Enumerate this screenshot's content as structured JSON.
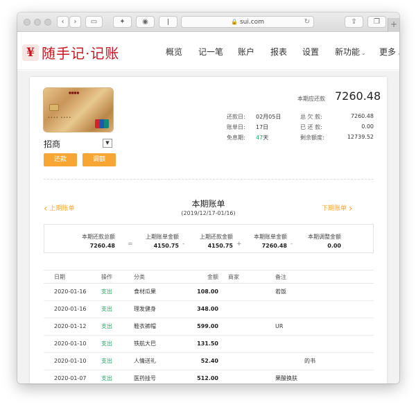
{
  "browser": {
    "url": "sui.com"
  },
  "site": {
    "logo_mark": "¥",
    "logo_text": "随手记·记账",
    "nav": [
      {
        "label": "概览"
      },
      {
        "label": "记一笔"
      },
      {
        "label": "账户"
      },
      {
        "label": "报表"
      },
      {
        "label": "设置"
      },
      {
        "label": "新功能"
      },
      {
        "label": "更多"
      }
    ]
  },
  "card": {
    "bank_name": "招商",
    "pay_button": "还款",
    "limit_button": "调额",
    "due_label": "本期应还款",
    "due_amount": "7260.48",
    "info_left": [
      {
        "label": "还款日:",
        "value": "02月05日"
      },
      {
        "label": "账单日:",
        "value": "17日"
      },
      {
        "label": "免息期:",
        "value_num": "47",
        "value_unit": "天"
      }
    ],
    "info_right": [
      {
        "label": "总 欠 款:",
        "value": "7260.48"
      },
      {
        "label": "已 还 款:",
        "value": "0.00"
      },
      {
        "label": "剩余额度:",
        "value": "12739.52"
      }
    ]
  },
  "bill": {
    "prev_label": "上期账单",
    "next_label": "下期账单",
    "title": "本期账单",
    "period": "(2019/12/17-01/16)",
    "summary": [
      {
        "label": "本期还款总额",
        "value": "7260.48"
      },
      {
        "label": "上期账单金额",
        "value": "4150.75"
      },
      {
        "label": "上期还款金额",
        "value": "4150.75"
      },
      {
        "label": "本期账单金额",
        "value": "7260.48"
      },
      {
        "label": "本期调整金额",
        "value": "0.00"
      }
    ],
    "operators": [
      "=",
      "-",
      "+",
      "-"
    ]
  },
  "table": {
    "headers": {
      "date": "日期",
      "op": "操作",
      "category": "分类",
      "amount": "金额",
      "merchant": "商家",
      "note": "备注"
    },
    "rows": [
      {
        "date": "2020-01-16",
        "op": "支出",
        "category": "食材瓜果",
        "amount": "108.00",
        "merchant": "",
        "note": "若饭"
      },
      {
        "date": "2020-01-16",
        "op": "支出",
        "category": "理发健身",
        "amount": "348.00",
        "merchant": "",
        "note": ""
      },
      {
        "date": "2020-01-12",
        "op": "支出",
        "category": "鞋衣裤帽",
        "amount": "599.00",
        "merchant": "",
        "note": "UR"
      },
      {
        "date": "2020-01-10",
        "op": "支出",
        "category": "铁航大巴",
        "amount": "131.50",
        "merchant": "",
        "note": ""
      },
      {
        "date": "2020-01-10",
        "op": "支出",
        "category": "人情送礼",
        "amount": "52.40",
        "merchant": "",
        "note": "的书"
      },
      {
        "date": "2020-01-07",
        "op": "支出",
        "category": "医药挂号",
        "amount": "512.00",
        "merchant": "",
        "note": "果酸换肤"
      }
    ]
  },
  "colors": {
    "brand_red": "#c8161e",
    "accent_orange": "#f7a634",
    "green": "#2aa663"
  }
}
